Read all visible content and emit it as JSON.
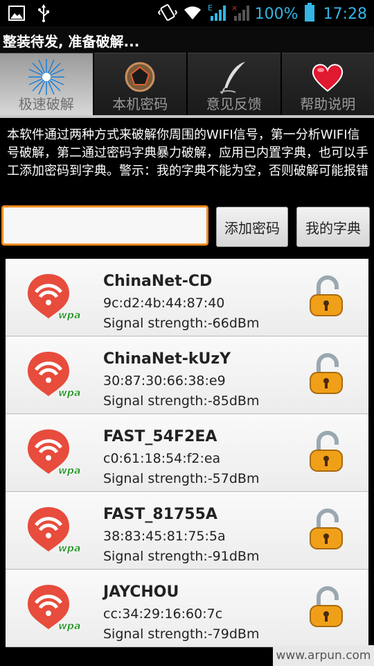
{
  "status_bar": {
    "battery_percent": "100%",
    "time": "17:28",
    "network_label": "E",
    "icons": [
      "image-icon",
      "usb-icon",
      "vibrate-icon",
      "wifi-signal-icon",
      "cell-signal-icon",
      "no-signal-icon",
      "battery-icon"
    ],
    "accent_color": "#33b5e5"
  },
  "title_bar": {
    "title": "整装待发, 准备破解..."
  },
  "tabs": [
    {
      "label": "极速破解",
      "icon": "starburst-icon",
      "active": true
    },
    {
      "label": "本机密码",
      "icon": "pentagon-icon",
      "active": false
    },
    {
      "label": "意见反馈",
      "icon": "quill-pen-icon",
      "active": false
    },
    {
      "label": "帮助说明",
      "icon": "heart-icon",
      "active": false
    }
  ],
  "description": "本软件通过两种方式来破解你周围的WIFI信号，第一分析WIFI信号破解，第二通过密码字典暴力破解，应用已内置字典，也可以手工添加密码到字典。警示：我的字典不能为空，否则破解可能报错",
  "input": {
    "value": "",
    "placeholder": ""
  },
  "buttons": {
    "add_password": "添加密码",
    "my_dictionary": "我的字典"
  },
  "networks": [
    {
      "ssid": "ChinaNet-CD",
      "mac": "9c:d2:4b:44:87:40",
      "signal": "Signal strength:-66dBm",
      "security": "wpa"
    },
    {
      "ssid": "ChinaNet-kUzY",
      "mac": "30:87:30:66:38:e9",
      "signal": "Signal strength:-85dBm",
      "security": "wpa"
    },
    {
      "ssid": "FAST_54F2EA",
      "mac": "c0:61:18:54:f2:ea",
      "signal": "Signal strength:-57dBm",
      "security": "wpa"
    },
    {
      "ssid": "FAST_81755A",
      "mac": "38:83:45:81:75:5a",
      "signal": "Signal strength:-91dBm",
      "security": "wpa"
    },
    {
      "ssid": "JAYCHOU",
      "mac": "cc:34:29:16:60:7c",
      "signal": "Signal strength:-79dBm",
      "security": "wpa"
    }
  ],
  "watermark": "www.arpun.com",
  "colors": {
    "input_border": "#f08a1c",
    "wifi_badge": "#e74c3c",
    "wpa_text": "#1a8f1a",
    "lock_body": "#f0a018"
  }
}
